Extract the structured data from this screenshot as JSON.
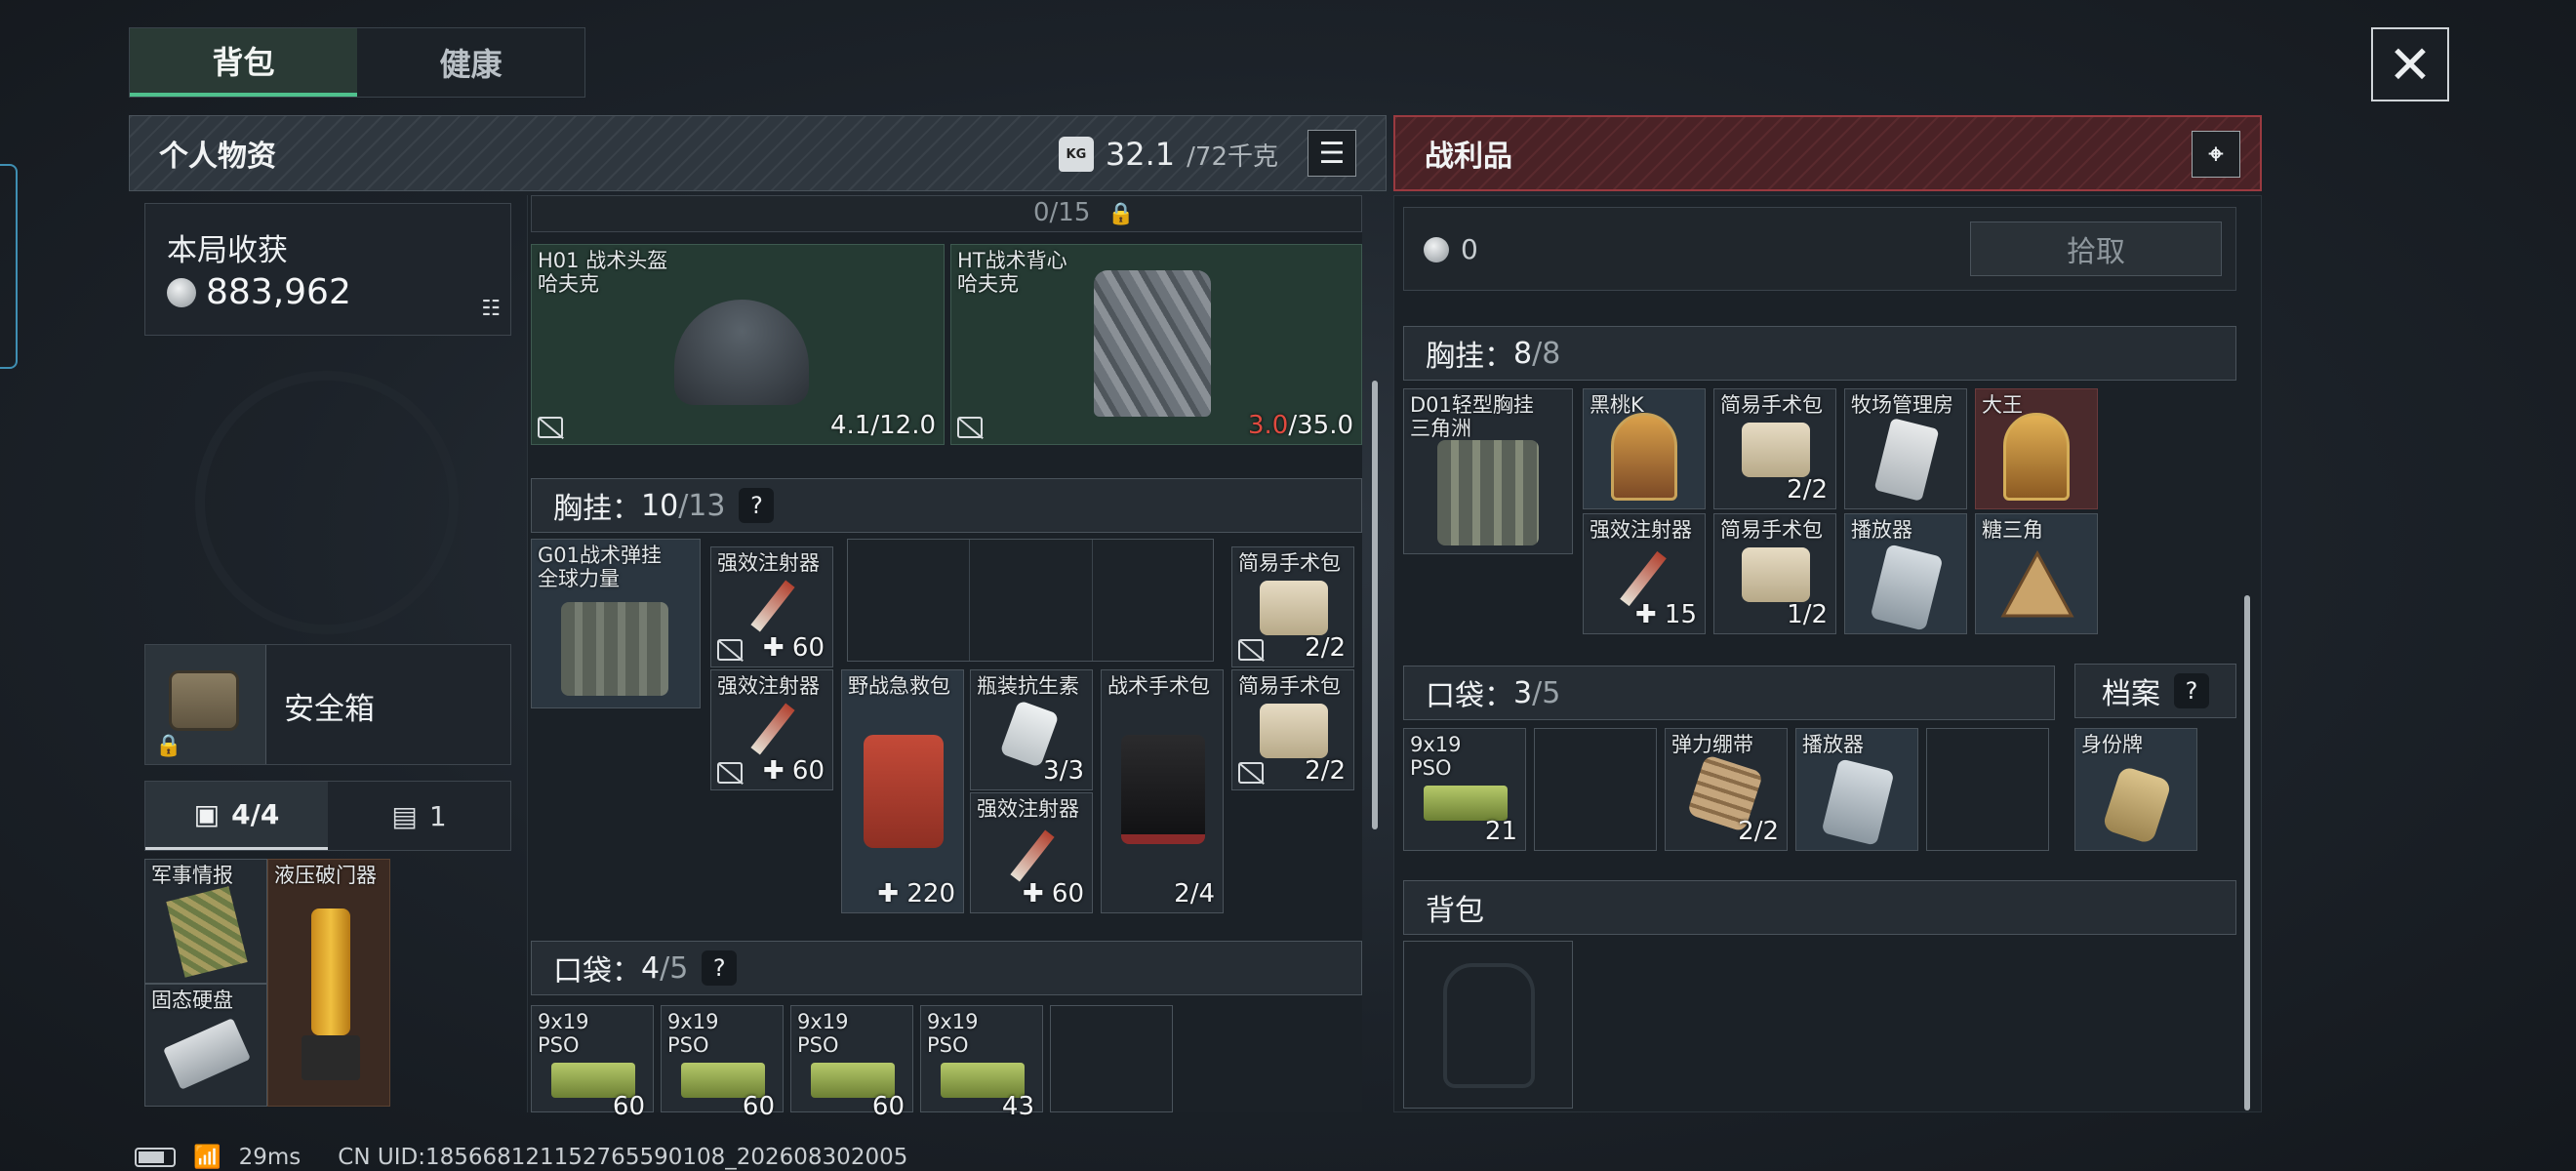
{
  "tabs": {
    "backpack": "背包",
    "health": "健康"
  },
  "left": {
    "title": "个人物资",
    "weight_current": "32.1",
    "weight_max": "/72千克",
    "kg_badge": "KG",
    "harvest_label": "本局收获",
    "harvest_value": "883,962",
    "safebox_label": "安全箱",
    "counter_tab1": "4/4",
    "counter_tab2": "1",
    "top_partial": "0/15",
    "helmet": {
      "name": "H01 战术头盔",
      "maker": "哈夫克",
      "durability": "4.1/12.0"
    },
    "vest": {
      "name": "HT战术背心",
      "maker": "哈夫克",
      "dur_current": "3.0",
      "dur_max": "/35.0"
    },
    "rig_header": {
      "label": "胸挂：",
      "used": "10",
      "cap": "/13",
      "q": "?"
    },
    "rig_item": {
      "name": "G01战术弹挂",
      "sub": "全球力量"
    },
    "inj1": {
      "name": "强效注射器",
      "value": "60"
    },
    "inj2": {
      "name": "强效注射器",
      "value": "60"
    },
    "medkit": {
      "name": "野战急救包",
      "value": "220"
    },
    "antibiotic": {
      "name": "瓶装抗生素",
      "value": "3/3"
    },
    "inj3": {
      "name": "强效注射器",
      "value": "60"
    },
    "tacpack": {
      "name": "战术手术包",
      "value": "2/4"
    },
    "surg1": {
      "name": "简易手术包",
      "value": "2/2"
    },
    "surg2": {
      "name": "简易手术包",
      "value": "2/2"
    },
    "pocket_header": {
      "label": "口袋：",
      "used": "4",
      "cap": "/5",
      "q": "?"
    },
    "ammo": [
      {
        "name": "9x19",
        "sub": "PSO",
        "value": "60"
      },
      {
        "name": "9x19",
        "sub": "PSO",
        "value": "60"
      },
      {
        "name": "9x19",
        "sub": "PSO",
        "value": "60"
      },
      {
        "name": "9x19",
        "sub": "PSO",
        "value": "43"
      }
    ],
    "safe_items": {
      "intel": "军事情报",
      "breacher": "液压破门器",
      "ssd": "固态硬盘"
    }
  },
  "right": {
    "title": "战利品",
    "value": "0",
    "pickup": "拾取",
    "rig_header": {
      "label": "胸挂：",
      "used": "8",
      "cap": "/8"
    },
    "rig_item": {
      "name": "D01轻型胸挂",
      "sub": "三角洲"
    },
    "items": {
      "peach": "黑桃K",
      "surg1": {
        "name": "简易手术包",
        "value": "2/2"
      },
      "ranch": "牧场管理房",
      "king": "大王",
      "inj": {
        "name": "强效注射器",
        "value": "15"
      },
      "surg2": {
        "name": "简易手术包",
        "value": "1/2"
      },
      "player": "播放器",
      "candy": "糖三角"
    },
    "pocket_header": {
      "label": "口袋：",
      "used": "3",
      "cap": "/5"
    },
    "archive": {
      "label": "档案",
      "q": "?"
    },
    "pocket_items": {
      "ammo": {
        "name": "9x19",
        "sub": "PSO",
        "value": "21"
      },
      "bandage": {
        "name": "弹力绷带",
        "value": "2/2"
      },
      "player": "播放器"
    },
    "dogtag": "身份牌",
    "backpack_header": "背包"
  },
  "status": {
    "ping": "29ms",
    "uid": "CN UID:185668121152765590108_202608302005"
  }
}
